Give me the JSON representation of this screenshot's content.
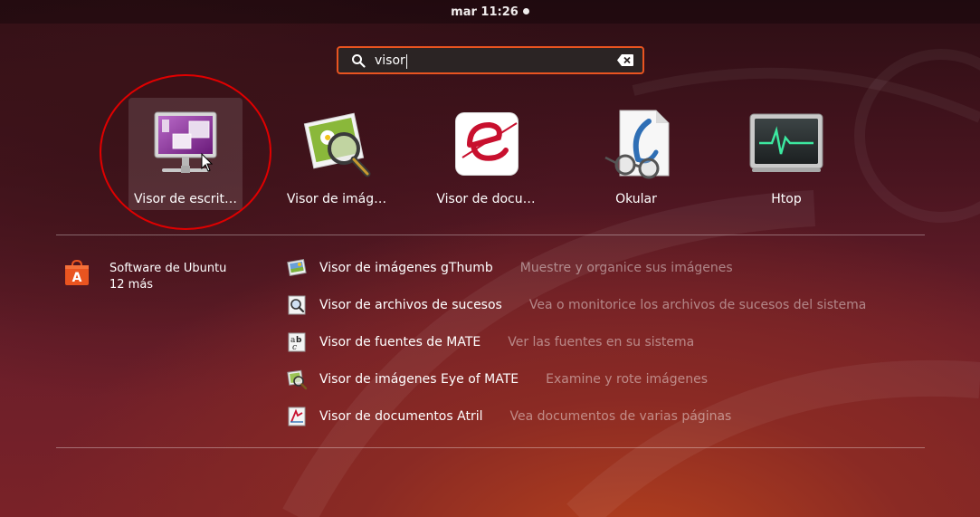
{
  "topbar": {
    "clock": "mar 11:26"
  },
  "search": {
    "value": "visor"
  },
  "apps": [
    {
      "label": "Visor de escrit…",
      "icon": "remote-desktop-viewer-icon"
    },
    {
      "label": "Visor de imág…",
      "icon": "image-viewer-icon"
    },
    {
      "label": "Visor de docu…",
      "icon": "document-viewer-icon"
    },
    {
      "label": "Okular",
      "icon": "okular-icon"
    },
    {
      "label": "Htop",
      "icon": "htop-icon"
    }
  ],
  "provider": {
    "name": "Software de Ubuntu",
    "count": "12 más"
  },
  "results": [
    {
      "name": "Visor de imágenes gThumb",
      "desc": "Muestre y organice sus imágenes"
    },
    {
      "name": "Visor de archivos de sucesos",
      "desc": "Vea o monitorice los archivos de sucesos del sistema"
    },
    {
      "name": "Visor de fuentes de MATE",
      "desc": "Ver las fuentes en su sistema"
    },
    {
      "name": "Visor de imágenes Eye of MATE",
      "desc": "Examine y rote imágenes"
    },
    {
      "name": "Visor de documentos Atril",
      "desc": "Vea documentos de varias páginas"
    }
  ],
  "colors": {
    "accent": "#e95420",
    "annotation": "#e00000"
  }
}
